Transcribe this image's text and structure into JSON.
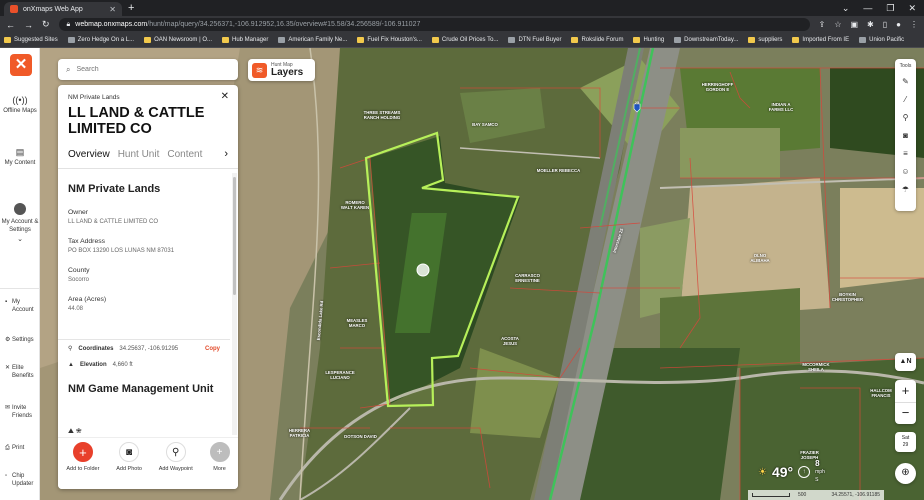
{
  "browser": {
    "tab_title": "onXmaps Web App",
    "tab_close": "✕",
    "new_tab": "+",
    "url_host": "webmap.onxmaps.com",
    "url_path": "/hunt/map/query/34.256371,-106.912952,16.35/overview#15.58/34.256589/-106.911027",
    "bookmarks": [
      "Suggested Sites",
      "Zero Hedge On a L...",
      "OAN Newsroom | O...",
      "Hub Manager",
      "American Family Ne...",
      "Fuel Fix Houston's...",
      "Crude Oil Prices To...",
      "DTN Fuel Buyer",
      "Rokslide Forum",
      "Hunting",
      "DownstreamToday...",
      "suppliers",
      "Imported From IE",
      "Union Pacific"
    ]
  },
  "nav": {
    "logo": "✕",
    "offline_maps": "Offline Maps",
    "my_content": "My Content",
    "my_account_settings": "My Account & Settings",
    "my_account": "My Account",
    "settings": "Settings",
    "elite_benefits": "Elite Benefits",
    "invite_friends": "Invite Friends",
    "print": "Print",
    "chip_updater": "Chip Updater"
  },
  "search": {
    "placeholder": "Search"
  },
  "layers": {
    "small": "Hunt Map",
    "big": "Layers"
  },
  "panel": {
    "kicker": "NM Private Lands",
    "title": "LL LAND & CATTLE LIMITED CO",
    "tabs": [
      "Overview",
      "Hunt Unit",
      "Content"
    ],
    "section_title": "NM Private Lands",
    "fields": [
      {
        "k": "Owner",
        "v": "LL LAND & CATTLE LIMITED CO"
      },
      {
        "k": "Tax Address",
        "v": "PO BOX 13290 LOS LUNAS NM 87031"
      },
      {
        "k": "County",
        "v": "Socorro"
      },
      {
        "k": "Area (Acres)",
        "v": "44.08"
      }
    ],
    "coords_label": "Coordinates",
    "coords_value": "34.25637, -106.91295",
    "copy": "Copy",
    "elevation_label": "Elevation",
    "elevation_value": "4,660 ft",
    "section2": "NM Game Management Unit",
    "actions": [
      "Add to Folder",
      "Add Photo",
      "Add Waypoint",
      "More"
    ]
  },
  "tools": {
    "title": "Tools"
  },
  "map": {
    "labels": [
      "THREE STREAMS RANCH HOLDING",
      "BAY SAMCO",
      "ROMERO WALT KAREN",
      "MOELLER REBECCA",
      "CARRASCO ERNESTINE",
      "MEASLES MARCO",
      "LESPERANCE LUCIANO",
      "ACOSTA JESUS",
      "DOTSON DAVID",
      "HERRERA PATRICIA",
      "INDIAN A FARMS LLC",
      "HERRINGHOFF GORDON E",
      "BOYKIN CHRISTOPHER",
      "MCCORMICK SHEILA",
      "HALLCOM FRANCIS",
      "FRAZIER JOSEPH",
      "OLNO ALIBAHA"
    ],
    "highway_shield": "25",
    "road_label_1": "Interstate 25",
    "road_label_2": "Escondida Lake Rd",
    "north": "N",
    "zoom_in": "+",
    "zoom_out": "−",
    "satellite": "Sat",
    "satellite_num": "29"
  },
  "weather": {
    "temp": "49°",
    "wind": "8",
    "wind_unit": "mph",
    "dir": "S"
  },
  "scale": {
    "text": "500",
    "attrib": "34.25571, -106.91185"
  }
}
